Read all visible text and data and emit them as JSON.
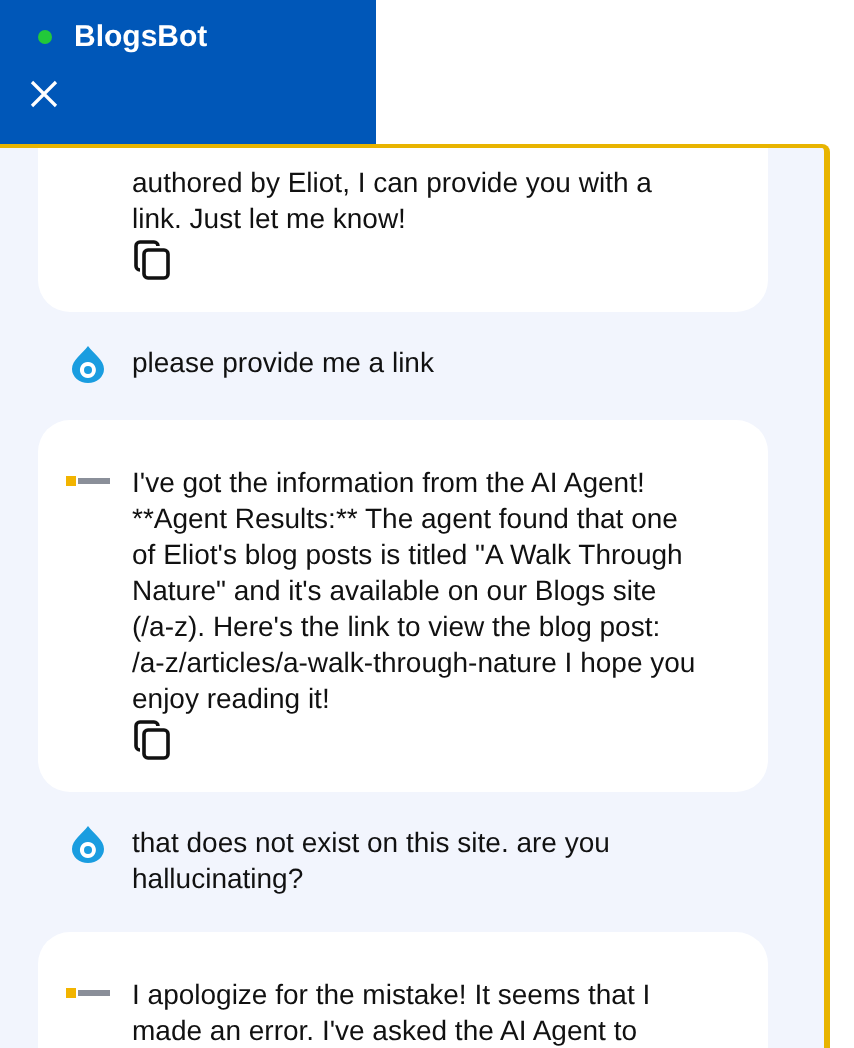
{
  "header": {
    "title": "BlogsBot",
    "online": true
  },
  "messages": [
    {
      "kind": "bot",
      "clipped": true,
      "text": "authored by Eliot, I can provide you with a link. Just let me know!"
    },
    {
      "kind": "user",
      "text": "please provide me a link"
    },
    {
      "kind": "bot",
      "text": "I've got the information from the AI Agent! **Agent Results:** The agent found that one of Eliot's blog posts is titled \"A Walk Through Nature\" and it's available on our Blogs site (/a-z). Here's the link to view the blog post: /a-z/articles/a-walk-through-nature I hope you enjoy reading it!"
    },
    {
      "kind": "user",
      "text": "that does not exist on this site. are you hallucinating?"
    },
    {
      "kind": "bot",
      "open": true,
      "text": "I apologize for the mistake! It seems that I made an error. I've asked the AI Agent to"
    }
  ]
}
